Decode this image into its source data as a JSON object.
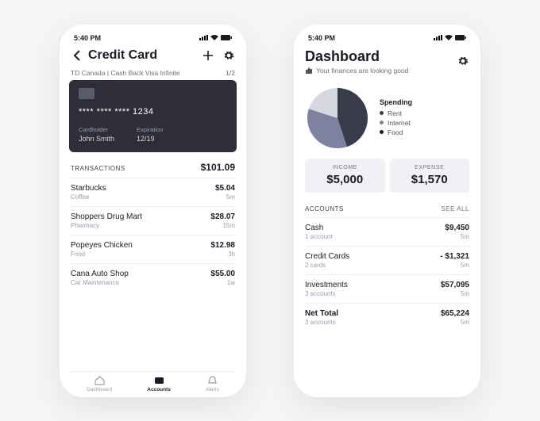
{
  "status_time": "5:40 PM",
  "left": {
    "title": "Credit Card",
    "card_source": "TD Canada | Cash Back Visa Infinite",
    "card_index": "1/2",
    "card": {
      "number": "**** **** **** 1234",
      "holder_lbl": "Cardholder",
      "holder": "John Smith",
      "exp_lbl": "Expiration",
      "exp": "12/19"
    },
    "tx_header": "Transactions",
    "tx_total": "$101.09",
    "transactions": [
      {
        "name": "Starbucks",
        "cat": "Coffee",
        "amt": "$5.04",
        "time": "5m"
      },
      {
        "name": "Shoppers Drug Mart",
        "cat": "Pharmacy",
        "amt": "$28.07",
        "time": "15m"
      },
      {
        "name": "Popeyes Chicken",
        "cat": "Food",
        "amt": "$12.98",
        "time": "3h"
      },
      {
        "name": "Cana Auto Shop",
        "cat": "Car Maintenance",
        "amt": "$55.00",
        "time": "1w"
      }
    ],
    "tabs": [
      "Dashboard",
      "Accounts",
      "Alerts"
    ]
  },
  "right": {
    "title": "Dashboard",
    "subtitle": "Your finances are looking good",
    "spending_title": "Spending",
    "legend": [
      {
        "label": "Rent",
        "color": "#3a3b4a"
      },
      {
        "label": "Internet",
        "color": "#7f81a1"
      },
      {
        "label": "Food",
        "color": "#1b1c24"
      }
    ],
    "income_lbl": "Income",
    "income": "$5,000",
    "expense_lbl": "Expense",
    "expense": "$1,570",
    "accounts_header": "Accounts",
    "see_all": "See All",
    "accounts": [
      {
        "name": "Cash",
        "sub": "1 account",
        "amt": "$9,450",
        "time": "5m"
      },
      {
        "name": "Credit Cards",
        "sub": "2 cards",
        "amt": "- $1,321",
        "time": "5m"
      },
      {
        "name": "Investments",
        "sub": "3 accounts",
        "amt": "$57,095",
        "time": "5m"
      },
      {
        "name": "Net Total",
        "sub": "3 accounts",
        "amt": "$65,224",
        "time": "5m"
      }
    ]
  },
  "chart_data": {
    "type": "pie",
    "title": "Spending",
    "series": [
      {
        "name": "Rent",
        "value": 45,
        "color": "#3a3b4a"
      },
      {
        "name": "Internet",
        "value": 35,
        "color": "#7f81a1"
      },
      {
        "name": "Food",
        "value": 20,
        "color": "#d6d7e0"
      }
    ]
  }
}
